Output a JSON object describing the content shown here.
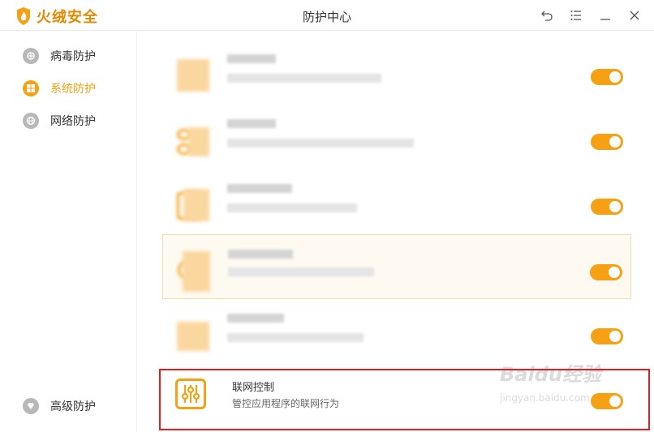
{
  "app": {
    "logo_text": "火绒安全",
    "window_title": "防护中心",
    "accent_color": "#f5a113",
    "controls": [
      "undo-icon",
      "menu-icon",
      "minimize-icon",
      "close-icon"
    ]
  },
  "sidebar": {
    "items": [
      {
        "label": "病毒防护",
        "icon": "virus-shield-icon",
        "active": false
      },
      {
        "label": "系统防护",
        "icon": "windows-icon",
        "active": true
      },
      {
        "label": "网络防护",
        "icon": "globe-icon",
        "active": false
      },
      {
        "label": "高级防护",
        "icon": "diamond-icon",
        "active": false
      }
    ]
  },
  "main": {
    "rows": [
      {
        "obscured": true,
        "toggle_on": true
      },
      {
        "obscured": true,
        "toggle_on": true
      },
      {
        "obscured": true,
        "toggle_on": true
      },
      {
        "obscured": true,
        "toggle_on": true,
        "highlighted": true
      },
      {
        "obscured": true,
        "toggle_on": true
      },
      {
        "title": "联网控制",
        "description": "管控应用程序的联网行为",
        "icon": "sliders-icon",
        "toggle_on": true
      }
    ]
  },
  "watermark": {
    "brand": "Baidu经验",
    "url": "jingyan.baidu.com"
  }
}
